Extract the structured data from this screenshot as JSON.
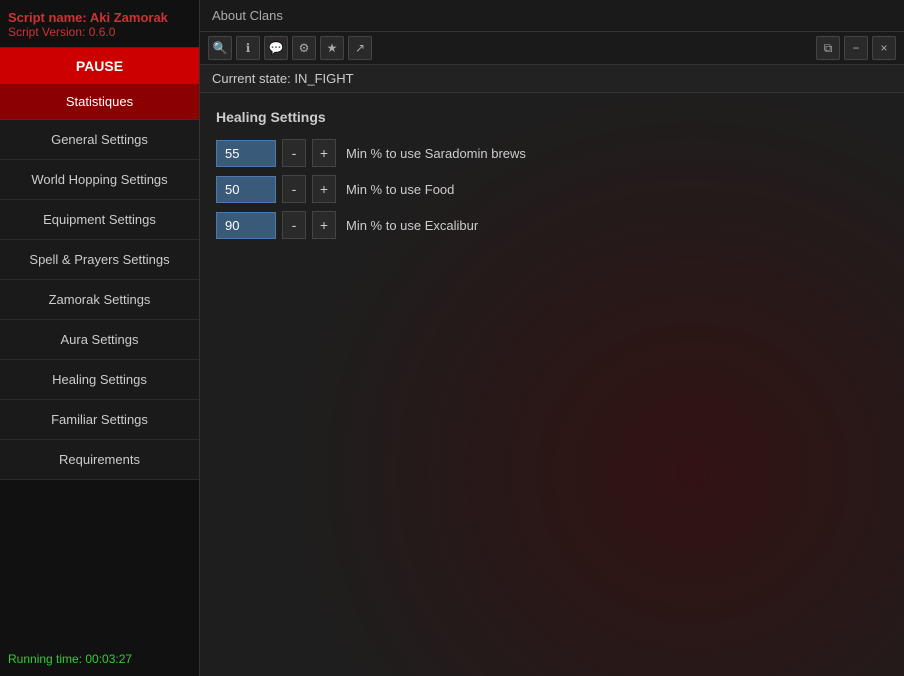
{
  "sidebar": {
    "script_name": "Script name: Aki Zamorak",
    "script_version": "Script Version: 0.6.0",
    "pause_label": "PAUSE",
    "statistiques_label": "Statistiques",
    "nav_items": [
      {
        "label": "General Settings",
        "id": "general-settings"
      },
      {
        "label": "World Hopping Settings",
        "id": "world-hopping-settings"
      },
      {
        "label": "Equipment Settings",
        "id": "equipment-settings"
      },
      {
        "label": "Spell & Prayers Settings",
        "id": "spell-prayers-settings"
      },
      {
        "label": "Zamorak Settings",
        "id": "zamorak-settings"
      },
      {
        "label": "Aura Settings",
        "id": "aura-settings"
      },
      {
        "label": "Healing Settings",
        "id": "healing-settings"
      },
      {
        "label": "Familiar Settings",
        "id": "familiar-settings"
      },
      {
        "label": "Requirements",
        "id": "requirements"
      }
    ],
    "running_time_label": "Running time: 00:03:27"
  },
  "topbar": {
    "title": "About Clans"
  },
  "toolbar": {
    "icons": [
      {
        "name": "search-icon",
        "symbol": "🔍"
      },
      {
        "name": "info-icon",
        "symbol": "ℹ"
      },
      {
        "name": "chat-icon",
        "symbol": "💬"
      },
      {
        "name": "settings-icon",
        "symbol": "⚙"
      },
      {
        "name": "bookmark-icon",
        "symbol": "★"
      },
      {
        "name": "export-icon",
        "symbol": "↗"
      }
    ],
    "right_icons": [
      {
        "name": "window-icon",
        "symbol": "⧉"
      },
      {
        "name": "minus-icon",
        "symbol": "−"
      },
      {
        "name": "close-icon",
        "symbol": "×"
      }
    ]
  },
  "state": {
    "current_state_label": "Current state: IN_FIGHT"
  },
  "healing_settings": {
    "section_title": "Healing Settings",
    "rows": [
      {
        "id": "saradomin-brews",
        "value": "55",
        "label": "Min % to use Saradomin brews"
      },
      {
        "id": "food",
        "value": "50",
        "label": "Min % to use Food"
      },
      {
        "id": "excalibur",
        "value": "90",
        "label": "Min % to use Excalibur"
      }
    ],
    "minus_label": "-",
    "plus_label": "+"
  }
}
